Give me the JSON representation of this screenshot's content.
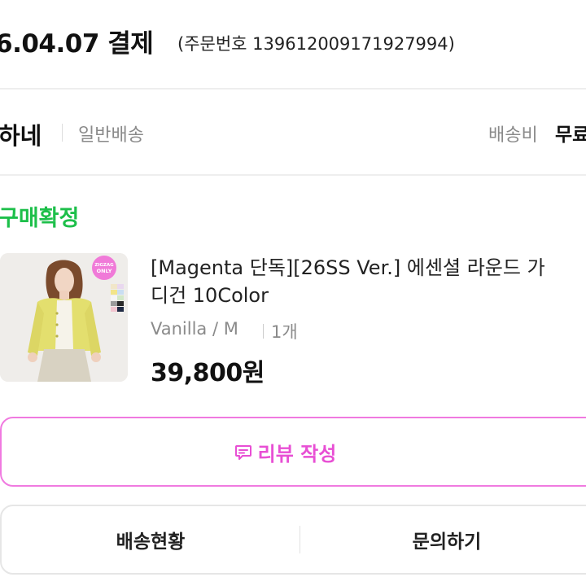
{
  "order": {
    "date_label": "6.04.07 결제",
    "order_number": "(주문번호 139612009171927994)"
  },
  "shop": {
    "name": "하네",
    "shipping_type": "일반배송",
    "shipping_fee_label": "배송비",
    "shipping_fee_value": "무료"
  },
  "status": {
    "label": "구매확정",
    "color": "#1dbf4a"
  },
  "product": {
    "title_line1": "[Magenta 단독][26SS Ver.] 에센셜 라운드 가",
    "title_line2": "디건 10Color",
    "option": "Vanilla / M",
    "quantity": "1개",
    "price": "39,800원",
    "image_badge": "ZIGZAG ONLY",
    "thumbnail_icon": "product-photo-cardigan"
  },
  "actions": {
    "review_label": "리뷰 작성",
    "review_icon": "review-speech-bubble-icon",
    "review_color": "#e84fd4",
    "shipping_status_label": "배송현황",
    "inquiry_label": "문의하기"
  }
}
